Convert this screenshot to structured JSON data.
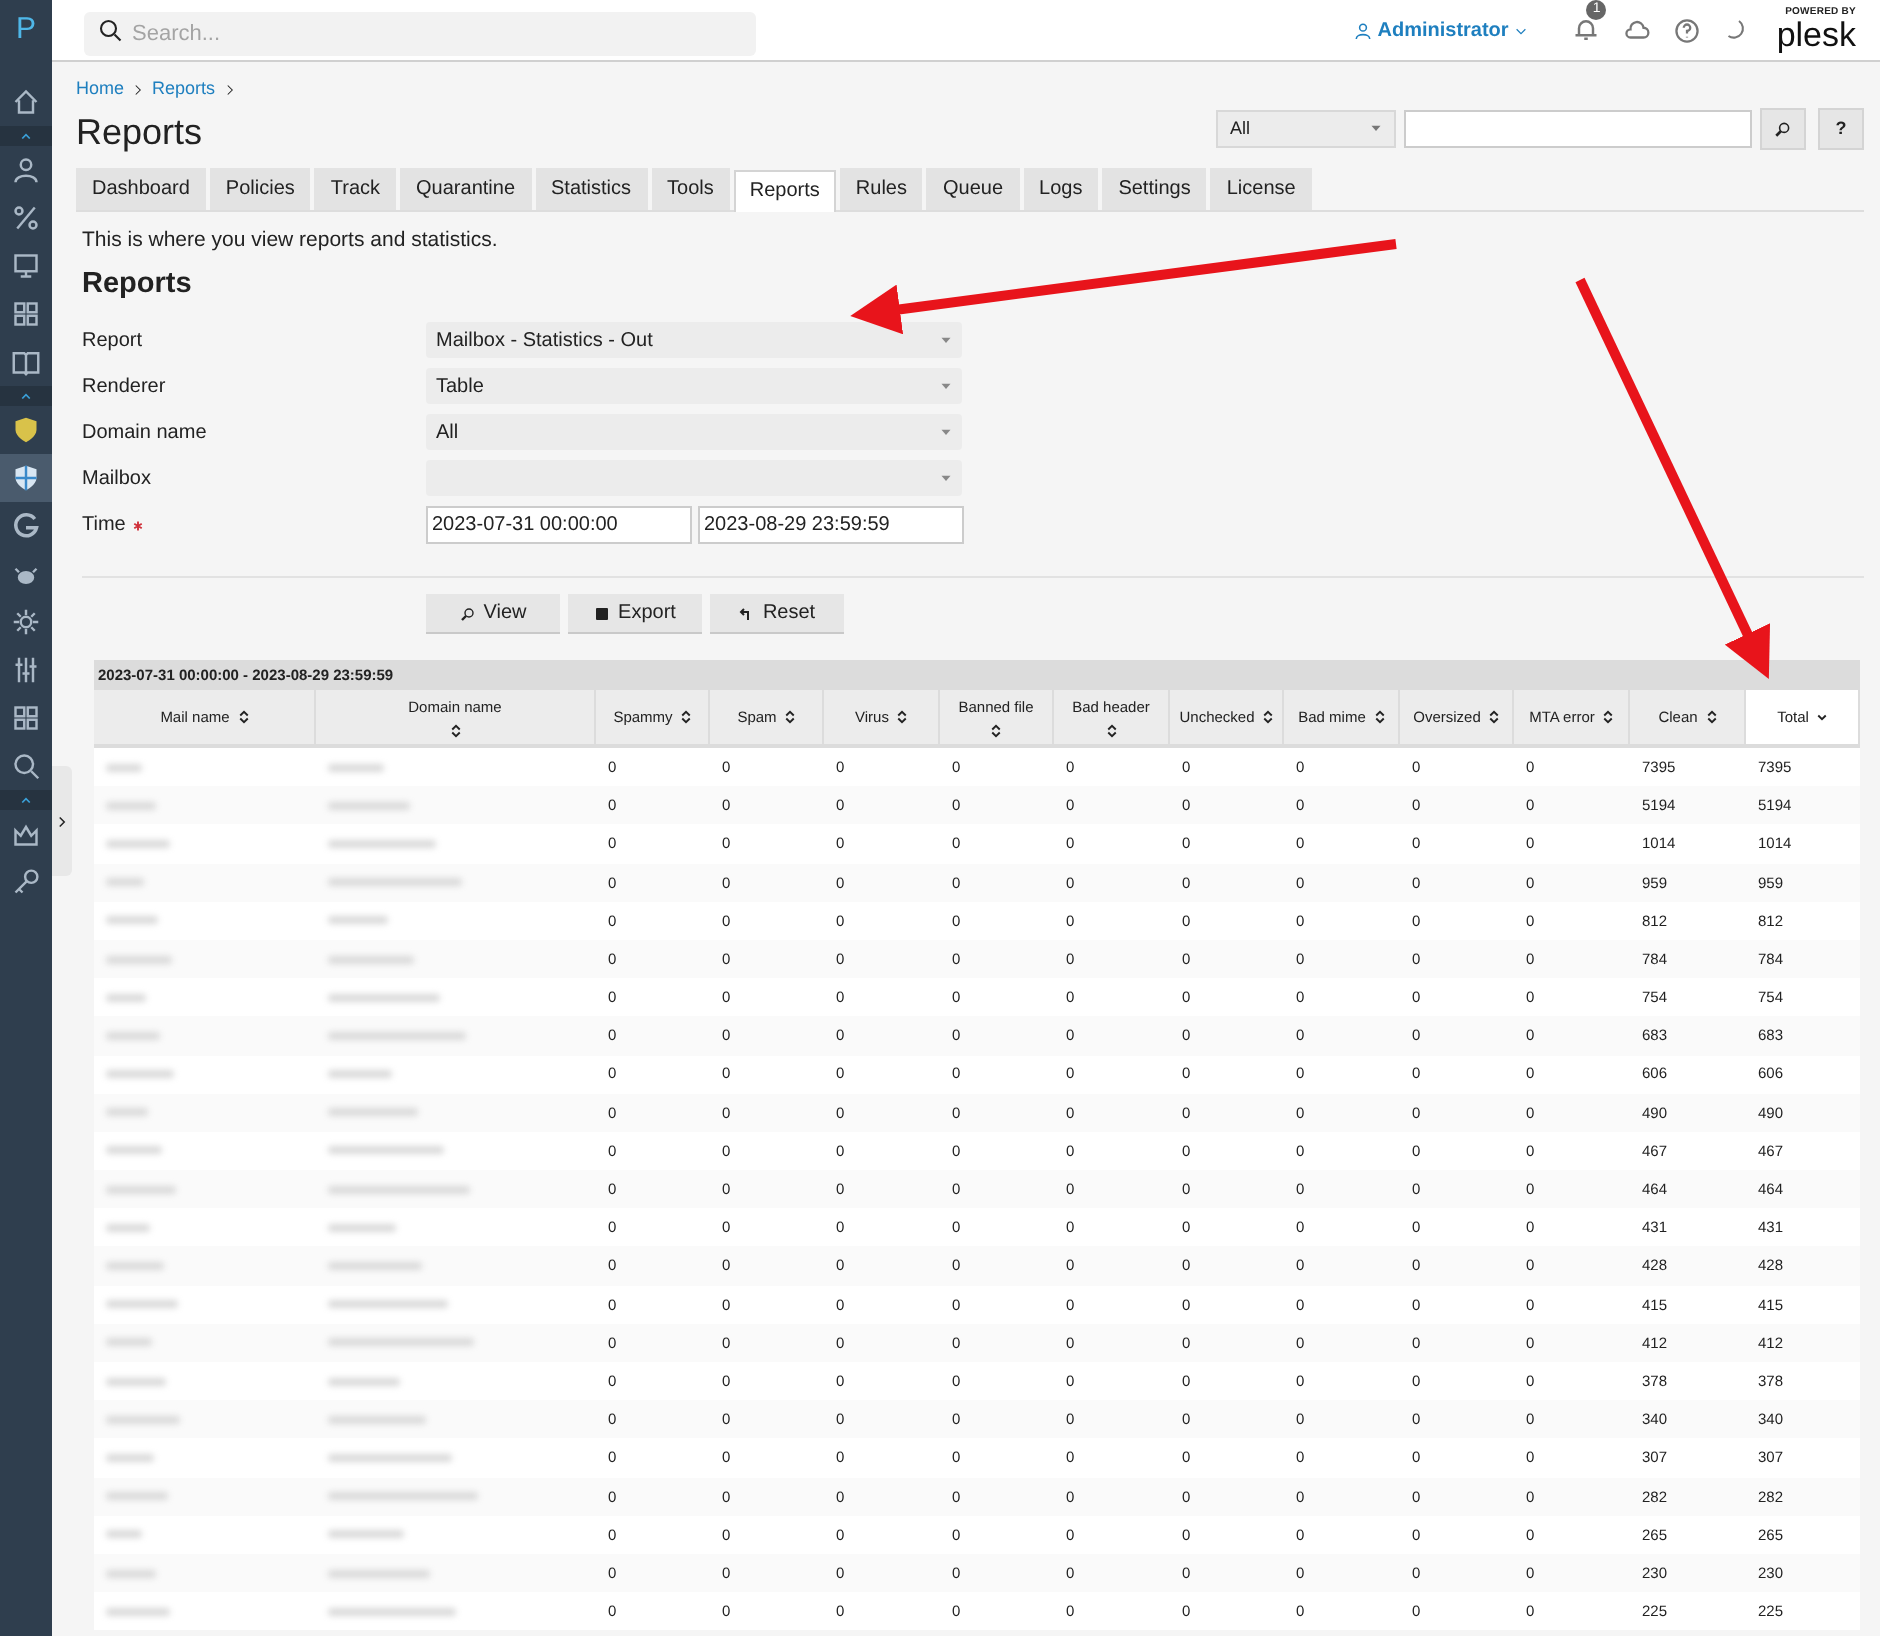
{
  "sidebar": {
    "logo": "P",
    "items": [
      {
        "kind": "home",
        "selected": false
      },
      {
        "kind": "collapse",
        "selected": false
      },
      {
        "kind": "user",
        "selected": false
      },
      {
        "kind": "percent",
        "selected": false
      },
      {
        "kind": "monitor",
        "selected": false
      },
      {
        "kind": "grid",
        "selected": false
      },
      {
        "kind": "book",
        "selected": false
      },
      {
        "kind": "collapse",
        "selected": false
      },
      {
        "kind": "shield",
        "selected": false
      },
      {
        "kind": "shield",
        "selected": true
      },
      {
        "kind": "g",
        "selected": false
      },
      {
        "kind": "bug",
        "selected": false
      },
      {
        "kind": "gear",
        "selected": false
      },
      {
        "kind": "sliders",
        "selected": false
      },
      {
        "kind": "grid",
        "selected": false
      },
      {
        "kind": "zoom",
        "selected": false
      },
      {
        "kind": "collapse",
        "selected": false
      },
      {
        "kind": "crown",
        "selected": false
      },
      {
        "kind": "key",
        "selected": false
      }
    ]
  },
  "topbar": {
    "search": {
      "placeholder": "Search..."
    },
    "user": "Administrator",
    "notifications": "1",
    "logo_caption": "POWERED BY",
    "logo": "plesk"
  },
  "breadcrumbs": [
    "Home",
    "Reports"
  ],
  "title": "Reports",
  "filter": {
    "select": "All",
    "help": "?"
  },
  "tabs": [
    {
      "label": "Dashboard",
      "selected": false
    },
    {
      "label": "Policies",
      "selected": false
    },
    {
      "label": "Track",
      "selected": false
    },
    {
      "label": "Quarantine",
      "selected": false
    },
    {
      "label": "Statistics",
      "selected": false
    },
    {
      "label": "Tools",
      "selected": false
    },
    {
      "label": "Reports",
      "selected": true
    },
    {
      "label": "Rules",
      "selected": false
    },
    {
      "label": "Queue",
      "selected": false
    },
    {
      "label": "Logs",
      "selected": false
    },
    {
      "label": "Settings",
      "selected": false
    },
    {
      "label": "License",
      "selected": false
    }
  ],
  "description": "This is where you view reports and statistics.",
  "form_title": "Reports",
  "fields": [
    {
      "label": "Report",
      "kind": "select",
      "value": "Mailbox - Statistics - Out",
      "required": false
    },
    {
      "label": "Renderer",
      "kind": "select",
      "value": "Table",
      "required": false
    },
    {
      "label": "Domain name",
      "kind": "select",
      "value": "All",
      "required": false
    },
    {
      "label": "Mailbox",
      "kind": "select",
      "required": false
    },
    {
      "label": "Time",
      "kind": "range",
      "from": "2023-07-31 00:00:00",
      "to": "2023-08-29 23:59:59",
      "required": true
    }
  ],
  "buttons": [
    {
      "label": "View",
      "kind": "search"
    },
    {
      "label": "Export",
      "kind": "save"
    },
    {
      "label": "Reset",
      "kind": "undo"
    }
  ],
  "table": {
    "caption": "2023-07-31 00:00:00 - 2023-08-29 23:59:59",
    "columns": [
      {
        "label": "Mail name",
        "sorted": false
      },
      {
        "label": "Domain name",
        "sorted": false
      },
      {
        "label": "Spammy",
        "sorted": false
      },
      {
        "label": "Spam",
        "sorted": false
      },
      {
        "label": "Virus",
        "sorted": false
      },
      {
        "label": "Banned file",
        "sorted": false
      },
      {
        "label": "Bad header",
        "sorted": false
      },
      {
        "label": "Unchecked",
        "sorted": false
      },
      {
        "label": "Bad mime",
        "sorted": false
      },
      {
        "label": "Oversized",
        "sorted": false
      },
      {
        "label": "MTA error",
        "sorted": false
      },
      {
        "label": "Clean",
        "sorted": false
      },
      {
        "label": "Total",
        "sorted": true
      }
    ],
    "rows": [
      [
        "",
        "",
        "0",
        "0",
        "0",
        "0",
        "0",
        "0",
        "0",
        "0",
        "0",
        "7395",
        "7395"
      ],
      [
        "",
        "",
        "0",
        "0",
        "0",
        "0",
        "0",
        "0",
        "0",
        "0",
        "0",
        "5194",
        "5194"
      ],
      [
        "",
        "",
        "0",
        "0",
        "0",
        "0",
        "0",
        "0",
        "0",
        "0",
        "0",
        "1014",
        "1014"
      ],
      [
        "",
        "",
        "0",
        "0",
        "0",
        "0",
        "0",
        "0",
        "0",
        "0",
        "0",
        "959",
        "959"
      ],
      [
        "",
        "",
        "0",
        "0",
        "0",
        "0",
        "0",
        "0",
        "0",
        "0",
        "0",
        "812",
        "812"
      ],
      [
        "",
        "",
        "0",
        "0",
        "0",
        "0",
        "0",
        "0",
        "0",
        "0",
        "0",
        "784",
        "784"
      ],
      [
        "",
        "",
        "0",
        "0",
        "0",
        "0",
        "0",
        "0",
        "0",
        "0",
        "0",
        "754",
        "754"
      ],
      [
        "",
        "",
        "0",
        "0",
        "0",
        "0",
        "0",
        "0",
        "0",
        "0",
        "0",
        "683",
        "683"
      ],
      [
        "",
        "",
        "0",
        "0",
        "0",
        "0",
        "0",
        "0",
        "0",
        "0",
        "0",
        "606",
        "606"
      ],
      [
        "",
        "",
        "0",
        "0",
        "0",
        "0",
        "0",
        "0",
        "0",
        "0",
        "0",
        "490",
        "490"
      ],
      [
        "",
        "",
        "0",
        "0",
        "0",
        "0",
        "0",
        "0",
        "0",
        "0",
        "0",
        "467",
        "467"
      ],
      [
        "",
        "",
        "0",
        "0",
        "0",
        "0",
        "0",
        "0",
        "0",
        "0",
        "0",
        "464",
        "464"
      ],
      [
        "",
        "",
        "0",
        "0",
        "0",
        "0",
        "0",
        "0",
        "0",
        "0",
        "0",
        "431",
        "431"
      ],
      [
        "",
        "",
        "0",
        "0",
        "0",
        "0",
        "0",
        "0",
        "0",
        "0",
        "0",
        "428",
        "428"
      ],
      [
        "",
        "",
        "0",
        "0",
        "0",
        "0",
        "0",
        "0",
        "0",
        "0",
        "0",
        "415",
        "415"
      ],
      [
        "",
        "",
        "0",
        "0",
        "0",
        "0",
        "0",
        "0",
        "0",
        "0",
        "0",
        "412",
        "412"
      ],
      [
        "",
        "",
        "0",
        "0",
        "0",
        "0",
        "0",
        "0",
        "0",
        "0",
        "0",
        "378",
        "378"
      ],
      [
        "",
        "",
        "0",
        "0",
        "0",
        "0",
        "0",
        "0",
        "0",
        "0",
        "0",
        "340",
        "340"
      ],
      [
        "",
        "",
        "0",
        "0",
        "0",
        "0",
        "0",
        "0",
        "0",
        "0",
        "0",
        "307",
        "307"
      ],
      [
        "",
        "",
        "0",
        "0",
        "0",
        "0",
        "0",
        "0",
        "0",
        "0",
        "0",
        "282",
        "282"
      ],
      [
        "",
        "",
        "0",
        "0",
        "0",
        "0",
        "0",
        "0",
        "0",
        "0",
        "0",
        "265",
        "265"
      ],
      [
        "",
        "",
        "0",
        "0",
        "0",
        "0",
        "0",
        "0",
        "0",
        "0",
        "0",
        "230",
        "230"
      ],
      [
        "",
        "",
        "0",
        "0",
        "0",
        "0",
        "0",
        "0",
        "0",
        "0",
        "0",
        "225",
        "225"
      ]
    ]
  }
}
